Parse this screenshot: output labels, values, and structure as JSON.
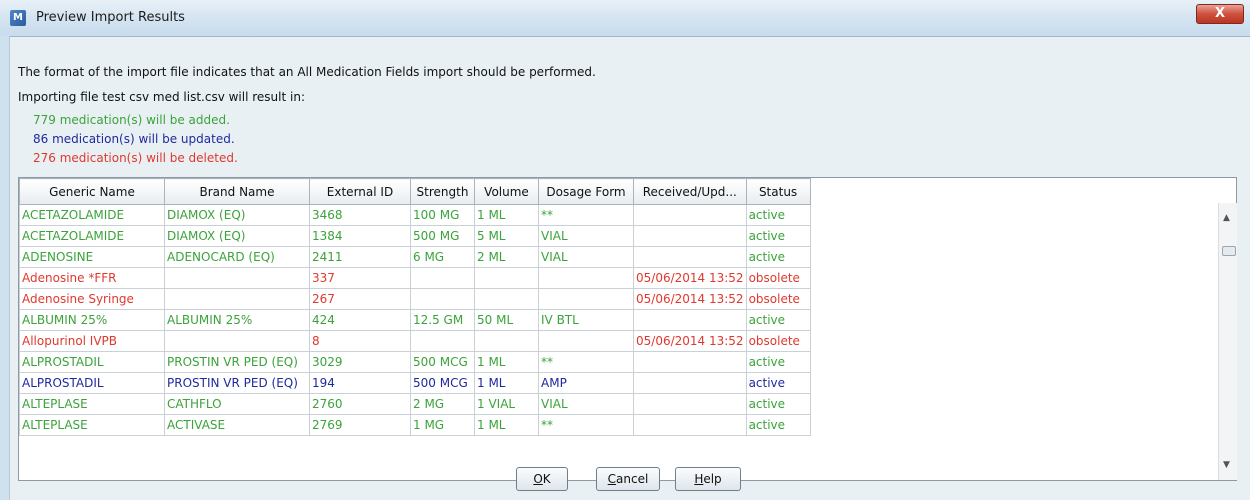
{
  "window": {
    "title": "Preview Import Results",
    "close_label": "X"
  },
  "messages": {
    "format": "The format of the import file indicates that an All Medication Fields import should be performed.",
    "importing": "Importing file test csv med list.csv will result in:",
    "added": "779 medication(s) will be added.",
    "updated": "86 medication(s) will be updated.",
    "deleted": "276 medication(s) will be deleted."
  },
  "colors": {
    "added": "#3aa33a",
    "updated": "#1f2a9e",
    "deleted": "#e0382f"
  },
  "table": {
    "columns": [
      "Generic Name",
      "Brand Name",
      "External ID",
      "Strength",
      "Volume",
      "Dosage Form",
      "Received/Upd...",
      "Status"
    ],
    "rows": [
      {
        "kind": "added",
        "cells": [
          "ACETAZOLAMIDE",
          "DIAMOX (EQ)",
          "3468",
          "100 MG",
          "1 ML",
          "**",
          "",
          "active"
        ]
      },
      {
        "kind": "added",
        "cells": [
          "ACETAZOLAMIDE",
          "DIAMOX (EQ)",
          "1384",
          "500 MG",
          "5 ML",
          "VIAL",
          "",
          "active"
        ]
      },
      {
        "kind": "added",
        "cells": [
          "ADENOSINE",
          "ADENOCARD (EQ)",
          "2411",
          "6 MG",
          "2 ML",
          "VIAL",
          "",
          "active"
        ]
      },
      {
        "kind": "deleted",
        "cells": [
          "Adenosine *FFR",
          "",
          "337",
          "",
          "",
          "",
          "05/06/2014 13:52",
          "obsolete"
        ]
      },
      {
        "kind": "deleted",
        "cells": [
          "Adenosine Syringe",
          "",
          "267",
          "",
          "",
          "",
          "05/06/2014 13:52",
          "obsolete"
        ]
      },
      {
        "kind": "added",
        "cells": [
          "ALBUMIN 25%",
          "ALBUMIN 25%",
          "424",
          "12.5 GM",
          "50 ML",
          "IV BTL",
          "",
          "active"
        ]
      },
      {
        "kind": "deleted",
        "cells": [
          "Allopurinol IVPB",
          "",
          "8",
          "",
          "",
          "",
          "05/06/2014 13:52",
          "obsolete"
        ]
      },
      {
        "kind": "added",
        "cells": [
          "ALPROSTADIL",
          "PROSTIN VR PED (EQ)",
          "3029",
          "500 MCG",
          "1 ML",
          "**",
          "",
          "active"
        ]
      },
      {
        "kind": "updated",
        "cells": [
          "ALPROSTADIL",
          "PROSTIN VR PED (EQ)",
          "194",
          "500 MCG",
          "1 ML",
          "AMP",
          "",
          "active"
        ]
      },
      {
        "kind": "added",
        "cells": [
          "ALTEPLASE",
          "CATHFLO",
          "2760",
          "2 MG",
          "1 VIAL",
          "VIAL",
          "",
          "active"
        ]
      },
      {
        "kind": "added",
        "cells": [
          "ALTEPLASE",
          "ACTIVASE",
          "2769",
          "1 MG",
          "1 ML",
          "**",
          "",
          "active"
        ]
      }
    ]
  },
  "buttons": {
    "ok": {
      "mnemonic": "O",
      "rest": "K"
    },
    "cancel": {
      "mnemonic": "C",
      "rest": "ancel"
    },
    "help": {
      "mnemonic": "H",
      "rest": "elp"
    }
  },
  "icons": {
    "app": "app-logo-icon",
    "close": "close-icon",
    "scroll_up": "scroll-up-arrow-icon",
    "scroll_down": "scroll-down-arrow-icon"
  }
}
